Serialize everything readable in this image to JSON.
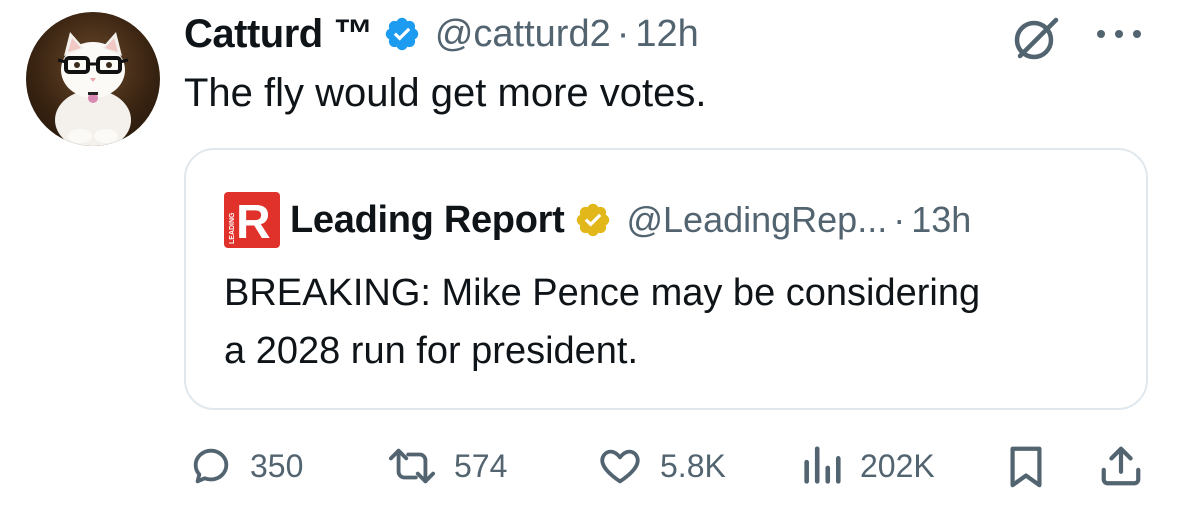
{
  "tweet": {
    "display_name": "Catturd ™",
    "handle": "@catturd2",
    "separator": "·",
    "time": "12h",
    "text": "The fly would get more votes."
  },
  "quote": {
    "display_name": "Leading Report",
    "handle": "@LeadingRep...",
    "separator": "·",
    "time": "13h",
    "text_line1": "BREAKING: Mike Pence may be considering",
    "text_line2": "a 2028 run for president.",
    "logo_letter": "R",
    "logo_side_text": "LEADING"
  },
  "actions": {
    "replies": "350",
    "reposts": "574",
    "likes": "5.8K",
    "views": "202K"
  },
  "colors": {
    "verified_blue": "#1d9bf0",
    "verified_gold": "#e2b719",
    "logo_red": "#e0322b",
    "muted": "#536471",
    "text": "#0f1419"
  },
  "icons": [
    "verified-badge-icon",
    "grok-icon",
    "more-icon",
    "reply-icon",
    "repost-icon",
    "like-icon",
    "views-icon",
    "bookmark-icon",
    "share-icon"
  ]
}
